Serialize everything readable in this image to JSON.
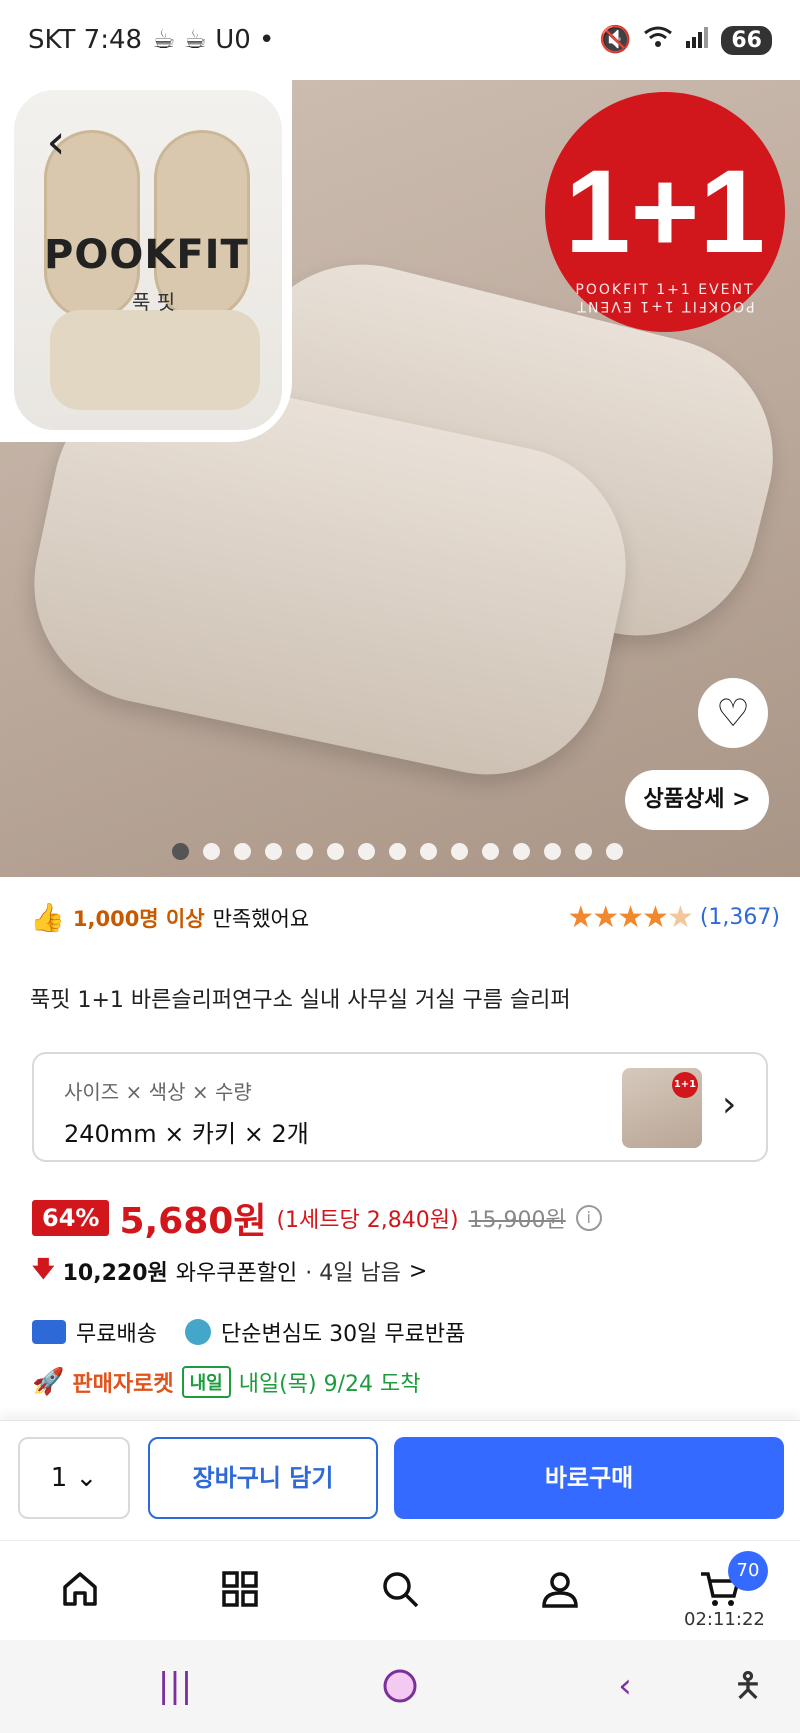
{
  "status_bar": {
    "carrier_time": "SKT 7:48",
    "left_icons": "☕ ☕ U0 •",
    "battery": "66"
  },
  "hero": {
    "package_brand": "POOKFIT",
    "package_sub": "푹 핏",
    "event_badge": {
      "main": "1+1",
      "top_text": "POOKFIT 1+1 EVENT",
      "bottom_text": "POOKFIT 1+1 EVENT"
    },
    "detail_button": "상품상세 >",
    "slide_count": 15,
    "active_slide": 1
  },
  "satisfaction": {
    "highlight": "1,000명 이상",
    "text": "만족했어요",
    "rating": 4.5,
    "review_count": "(1,367)"
  },
  "product_title": "푹핏 1+1 바른슬리퍼연구소 실내 사무실 거실 구름 슬리퍼",
  "option": {
    "label": "사이즈 × 색상 × 수량",
    "value": "240mm × 카키 × 2개",
    "thumb_badge": "1+1"
  },
  "price": {
    "discount": "64%",
    "sale_price": "5,680원",
    "per_set": "(1세트당 2,840원)",
    "original": "15,900원"
  },
  "coupon": {
    "amount": "10,220원",
    "label": "와우쿠폰할인",
    "remaining": "· 4일 남음",
    "chevron": ">"
  },
  "shipping": {
    "free_ship": "무료배송",
    "return": "단순변심도 30일 무료반품"
  },
  "rocket": {
    "label": "판매자로켓",
    "tomorrow_tag": "내일",
    "arrival": "내일(목) 9/24 도착"
  },
  "buy_bar": {
    "quantity": "1",
    "cart_button": "장바구니 담기",
    "buy_button": "바로구매"
  },
  "bottom_nav": {
    "cart_count": "70",
    "timer": "02:11:22"
  },
  "colors": {
    "accent_blue": "#346aff",
    "sale_red": "#d2171c",
    "star_orange": "#f2882d",
    "rocket_orange": "#e0531b",
    "delivery_green": "#1c9c3c"
  }
}
